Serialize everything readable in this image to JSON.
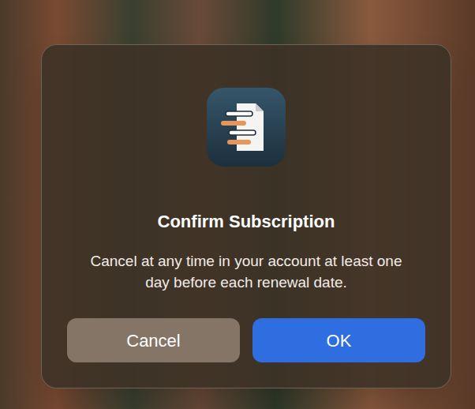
{
  "dialog": {
    "title": "Confirm Subscription",
    "message": "Cancel at any time in your account at least one day before each renewal date."
  },
  "buttons": [
    {
      "label": "Cancel",
      "default": false
    },
    {
      "label": "OK",
      "default": true
    }
  ]
}
